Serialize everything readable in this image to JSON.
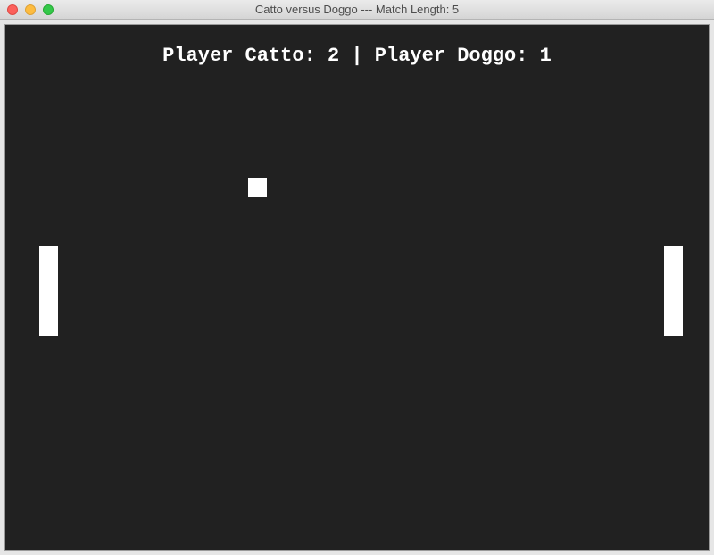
{
  "window": {
    "title": "Catto versus Doggo --- Match Length: 5"
  },
  "score": {
    "player1_label": "Player Catto:",
    "player1_score": "2",
    "separator": "|",
    "player2_label": "Player Doggo:",
    "player2_score": "1"
  },
  "colors": {
    "court": "#212121",
    "foreground": "#ffffff"
  },
  "icons": {
    "close": "close-dot-icon",
    "minimize": "minimize-dot-icon",
    "maximize": "maximize-dot-icon"
  }
}
